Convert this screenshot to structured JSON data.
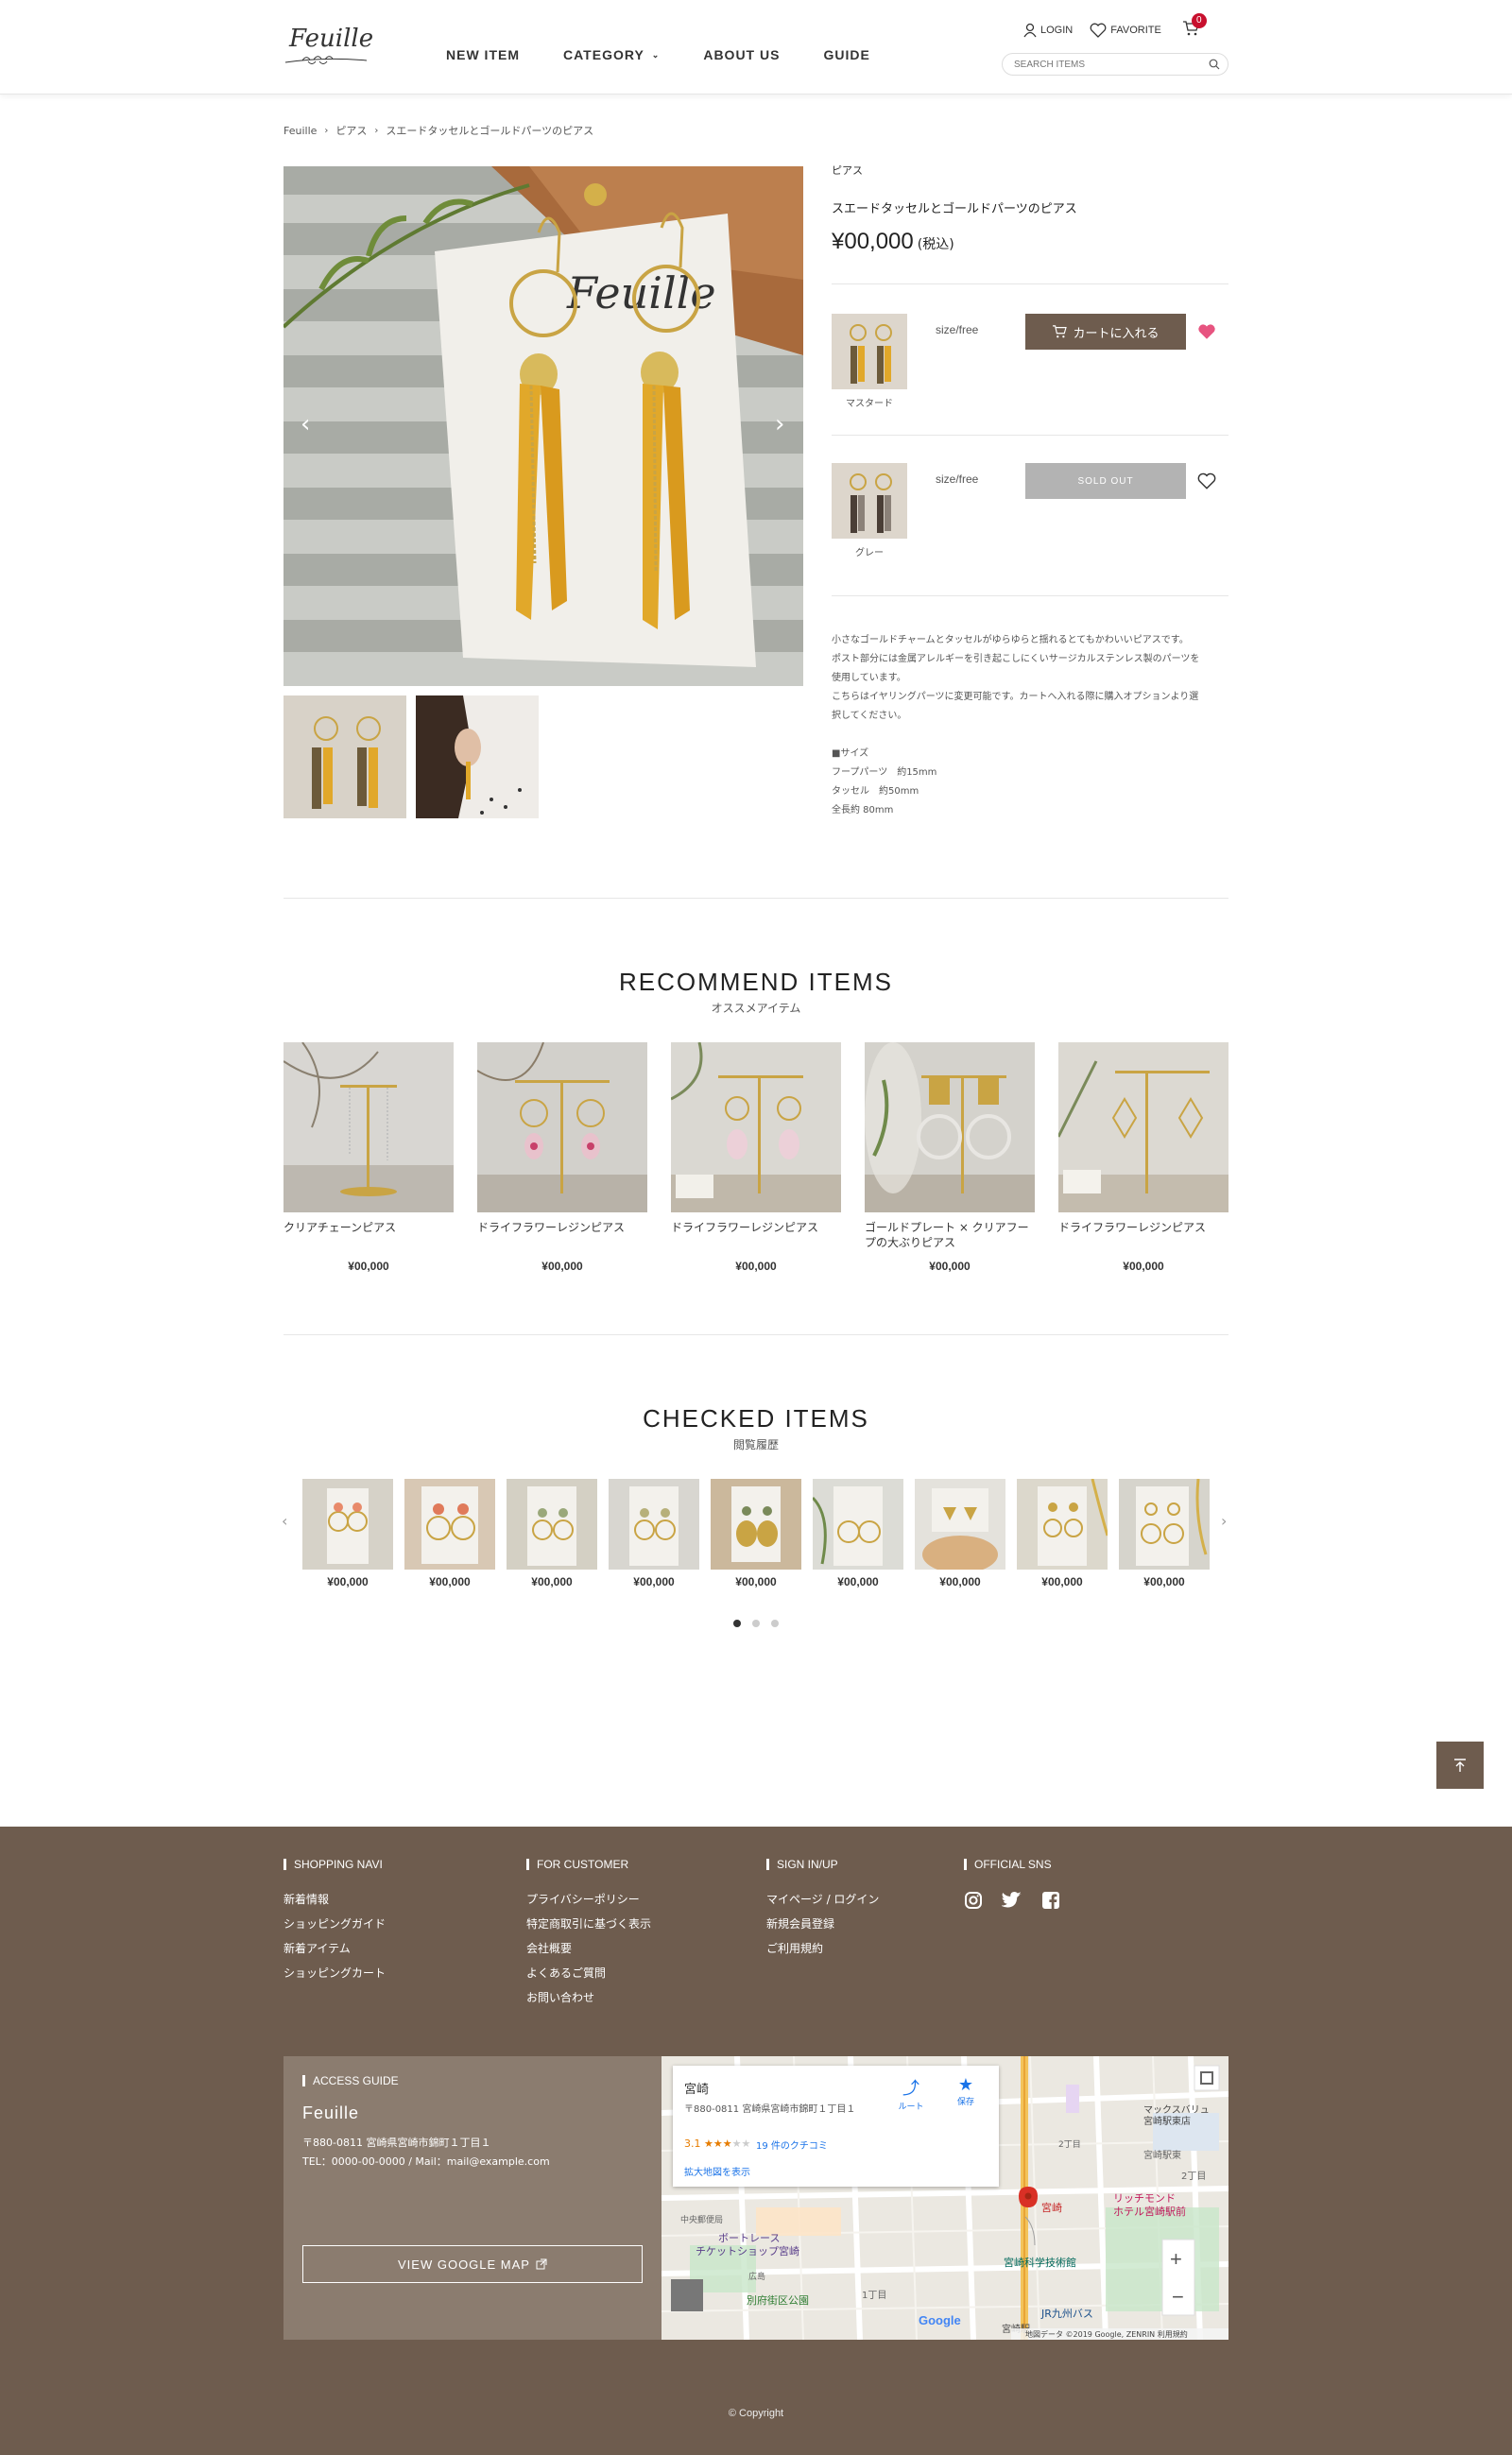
{
  "header": {
    "logo": "Feuille",
    "nav": [
      "NEW ITEM",
      "CATEGORY",
      "ABOUT US",
      "GUIDE"
    ],
    "login": "LOGIN",
    "favorite": "FAVORITE",
    "cart_count": "0",
    "search_placeholder": "SEARCH ITEMS"
  },
  "breadcrumb": [
    "Feuille",
    "ピアス",
    "スエードタッセルとゴールドパーツのピアス"
  ],
  "product": {
    "category": "ピアス",
    "name": "スエードタッセルとゴールドパーツのピアス",
    "price": "¥00,000",
    "tax": "(税込)",
    "variants": [
      {
        "label": "マスタード",
        "size": "size/free",
        "button": "カートに入れる",
        "status": "available",
        "favorited": true
      },
      {
        "label": "グレー",
        "size": "size/free",
        "button": "SOLD OUT",
        "status": "sold_out",
        "favorited": false
      }
    ],
    "description": [
      "小さなゴールドチャームとタッセルがゆらゆらと揺れるとてもかわいいピアスです。",
      "ポスト部分には金属アレルギーを引き起こしにくいサージカルステンレス製のパーツを",
      "使用しています。",
      "こちらはイヤリングパーツに変更可能です。カートへ入れる際に購入オプションより選",
      "択してください。"
    ],
    "spec_title": "■サイズ",
    "spec": [
      "フープパーツ　約15mm",
      "タッセル　約50mm",
      "全長約 80mm"
    ]
  },
  "recommend": {
    "title": "RECOMMEND ITEMS",
    "subtitle": "オススメアイテム",
    "items": [
      {
        "name": "クリアチェーンピアス",
        "price": "¥00,000"
      },
      {
        "name": "ドライフラワーレジンピアス",
        "price": "¥00,000"
      },
      {
        "name": "ドライフラワーレジンピアス",
        "price": "¥00,000"
      },
      {
        "name": "ゴールドプレート × クリアフープの大ぶりピアス",
        "price": "¥00,000"
      },
      {
        "name": "ドライフラワーレジンピアス",
        "price": "¥00,000"
      }
    ]
  },
  "checked": {
    "title": "CHECKED ITEMS",
    "subtitle": "閲覧履歴",
    "prices": [
      "¥00,000",
      "¥00,000",
      "¥00,000",
      "¥00,000",
      "¥00,000",
      "¥00,000",
      "¥00,000",
      "¥00,000",
      "¥00,000"
    ]
  },
  "footer": {
    "shopping_navi": {
      "title": "SHOPPING NAVI",
      "links": [
        "新着情報",
        "ショッピングガイド",
        "新着アイテム",
        "ショッピングカート"
      ]
    },
    "for_customer": {
      "title": "FOR CUSTOMER",
      "links": [
        "プライバシーポリシー",
        "特定商取引に基づく表示",
        "会社概要",
        "よくあるご質問",
        "お問い合わせ"
      ]
    },
    "sign_in": {
      "title": "SIGN IN/UP",
      "links": [
        "マイページ / ログイン",
        "新規会員登録",
        "ご利用規約"
      ]
    },
    "sns": {
      "title": "OFFICIAL SNS",
      "icons": [
        "instagram-icon",
        "twitter-icon",
        "facebook-icon"
      ]
    },
    "access": {
      "title": "ACCESS GUIDE",
      "shop": "Feuille",
      "address": "〒880-0811 宮崎県宮崎市錦町１丁目１",
      "contact": "TEL：0000-00-0000 / Mail：mail@example.com",
      "map_button": "VIEW GOOGLE MAP"
    },
    "map": {
      "place": "宮崎",
      "address": "〒880-0811 宮崎県宮崎市錦町１丁目１",
      "rating": "3.1",
      "reviews": "19 件のクチコミ",
      "enlarge": "拡大地図を表示",
      "route": "ルート",
      "save": "保存",
      "labels": [
        "マックスバリュ",
        "宮崎駅東店",
        "宮崎駅東",
        "2丁目",
        "リッチモンド",
        "ホテル宮崎駅前",
        "宮崎",
        "中央郵便局",
        "ボートレース",
        "チケットショップ宮崎",
        "広島",
        "1丁目",
        "宮崎科学技術館",
        "別府街区公園",
        "JR九州バス",
        "2丁目",
        "宮崎駅"
      ],
      "attribution": "地図データ ©2019 Google, ZENRIN   利用規約"
    },
    "copyright": "© Copyright"
  },
  "colors": {
    "brand": "#6e5c4e",
    "accent_heart": "#e75480",
    "badge": "#c8102e"
  }
}
